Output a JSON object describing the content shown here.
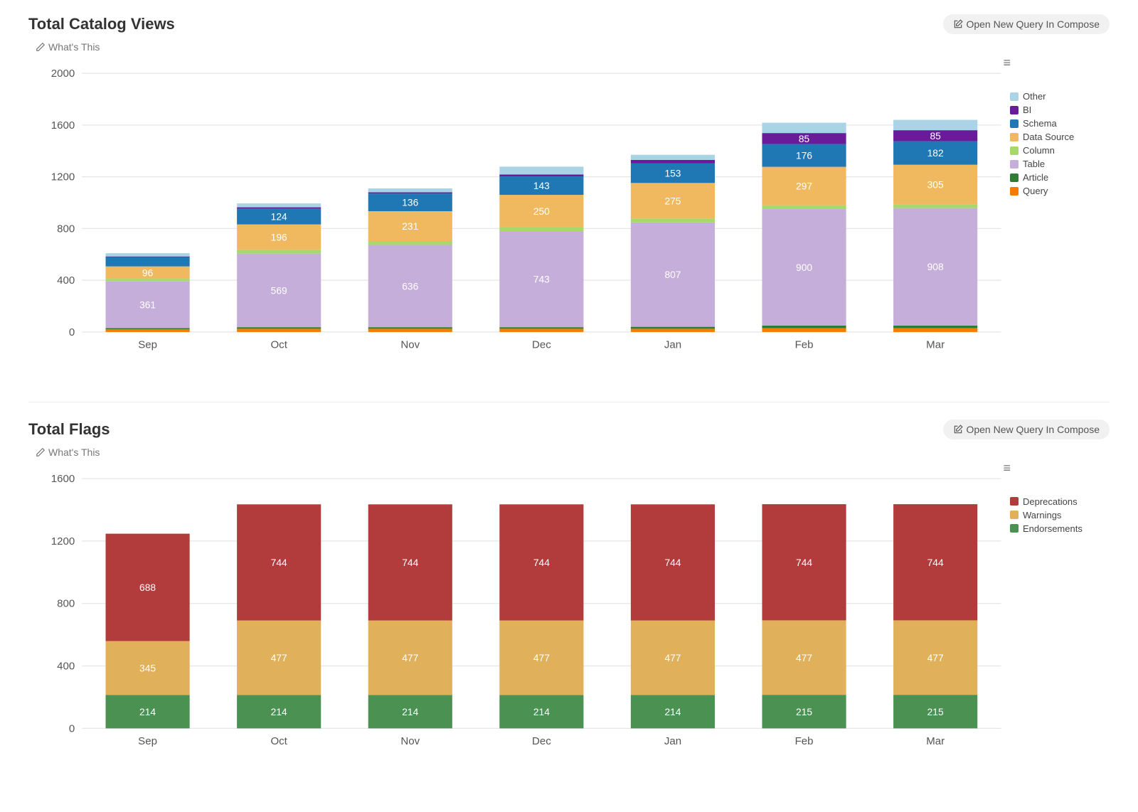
{
  "panels": [
    {
      "title": "Total Catalog Views",
      "open_query_label": "Open New Query In Compose",
      "whats_this_label": "What's This"
    },
    {
      "title": "Total Flags",
      "open_query_label": "Open New Query In Compose",
      "whats_this_label": "What's This"
    }
  ],
  "chart_data": [
    {
      "type": "bar",
      "stacked": true,
      "title": "Total Catalog Views",
      "ylim": [
        0,
        2000
      ],
      "yticks": [
        0,
        400,
        800,
        1200,
        1600,
        2000
      ],
      "categories": [
        "Sep",
        "Oct",
        "Nov",
        "Dec",
        "Jan",
        "Feb",
        "Mar"
      ],
      "series": [
        {
          "name": "Query",
          "color": "#f57c00",
          "values": [
            20,
            25,
            25,
            25,
            25,
            30,
            30
          ]
        },
        {
          "name": "Article",
          "color": "#2e7d32",
          "values": [
            10,
            12,
            12,
            12,
            15,
            20,
            20
          ]
        },
        {
          "name": "Table",
          "color": "#c6aedb",
          "values": [
            361,
            569,
            636,
            743,
            807,
            900,
            908
          ]
        },
        {
          "name": "Column",
          "color": "#a6d96a",
          "values": [
            20,
            30,
            30,
            30,
            30,
            30,
            30
          ]
        },
        {
          "name": "Data Source",
          "color": "#f0b95f",
          "values": [
            96,
            196,
            231,
            250,
            275,
            297,
            305
          ]
        },
        {
          "name": "Schema",
          "color": "#1f77b4",
          "values": [
            72,
            124,
            136,
            143,
            153,
            176,
            182
          ]
        },
        {
          "name": "BI",
          "color": "#6a1b9a",
          "values": [
            5,
            8,
            10,
            15,
            25,
            85,
            85
          ]
        },
        {
          "name": "Other",
          "color": "#a8d4e6",
          "values": [
            25,
            30,
            30,
            60,
            40,
            80,
            80
          ]
        }
      ],
      "legend_order": [
        "Other",
        "BI",
        "Schema",
        "Data Source",
        "Column",
        "Table",
        "Article",
        "Query"
      ],
      "label_series": [
        "Table",
        "Data Source",
        "Schema",
        "BI"
      ],
      "min_label_height": 40
    },
    {
      "type": "bar",
      "stacked": true,
      "title": "Total Flags",
      "ylim": [
        0,
        1600
      ],
      "yticks": [
        0,
        400,
        800,
        1200,
        1600
      ],
      "categories": [
        "Sep",
        "Oct",
        "Nov",
        "Dec",
        "Jan",
        "Feb",
        "Mar"
      ],
      "series": [
        {
          "name": "Endorsements",
          "color": "#4a9152",
          "values": [
            214,
            214,
            214,
            214,
            214,
            215,
            215
          ]
        },
        {
          "name": "Warnings",
          "color": "#e0b05a",
          "values": [
            345,
            477,
            477,
            477,
            477,
            477,
            477
          ]
        },
        {
          "name": "Deprecations",
          "color": "#b23b3b",
          "values": [
            688,
            744,
            744,
            744,
            744,
            744,
            744
          ]
        }
      ],
      "legend_order": [
        "Deprecations",
        "Warnings",
        "Endorsements"
      ],
      "label_series": [
        "Endorsements",
        "Warnings",
        "Deprecations"
      ],
      "min_label_height": 0
    }
  ]
}
